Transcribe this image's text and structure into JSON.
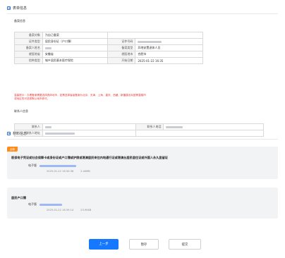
{
  "form_section": {
    "title": "表单信息",
    "filer_subhead": "备案信息",
    "fields": {
      "target_label": "备案对象",
      "target_value": "为自己备案",
      "idtype_label": "证件类型",
      "idtype_value": "居民身份证（户口簿）",
      "idno_label": "证件号码",
      "name_label": "备案人姓名",
      "type_label": "备案类型",
      "type_value": "异地安置退休人员",
      "insured_prov_label": "就医地省",
      "insured_prov_value": "安徽省",
      "insured_city_label": "就医地市",
      "insured_city_value": "合肥市",
      "insurance_label": "险种类型",
      "insurance_value": "城乡居民基本医疗保险",
      "start_label": "开始日期",
      "start_value": "2025-01-22 16:35"
    },
    "notice": "温馨提示：办理备案需要选择具体地市，如需选择省级备案为北京、天津、上海、重庆、西藏、新疆建设兵团等直辖市或地区的可选择默认地市即可。",
    "contact_subhead": "联系人信息",
    "contact": {
      "name_label": "联系人",
      "phone_label": "联系人电话",
      "addr_label": "联系人地址"
    }
  },
  "material_section": {
    "title": "材料信息",
    "required_tag": "必填",
    "items": [
      {
        "title": "医保电子凭证或社会保障卡或身份证或户口簿或护照或港澳居民来往内地通行证或港澳台居民居住证或外国人永久居留证",
        "sub_label": "电子版",
        "date": "2025-01-22 16:30:36",
        "size": "2.44MB"
      },
      {
        "title": "居民户口簿",
        "sub_label": "电子版",
        "date": "2025-01-22 16:39:14",
        "size": "23.90KB"
      }
    ]
  },
  "buttons": {
    "prev": "上一步",
    "save": "暂存",
    "submit": "提交"
  },
  "colors": {
    "primary": "#1677ff",
    "tag": "#ff8c1a",
    "notice": "#e83a3a"
  }
}
